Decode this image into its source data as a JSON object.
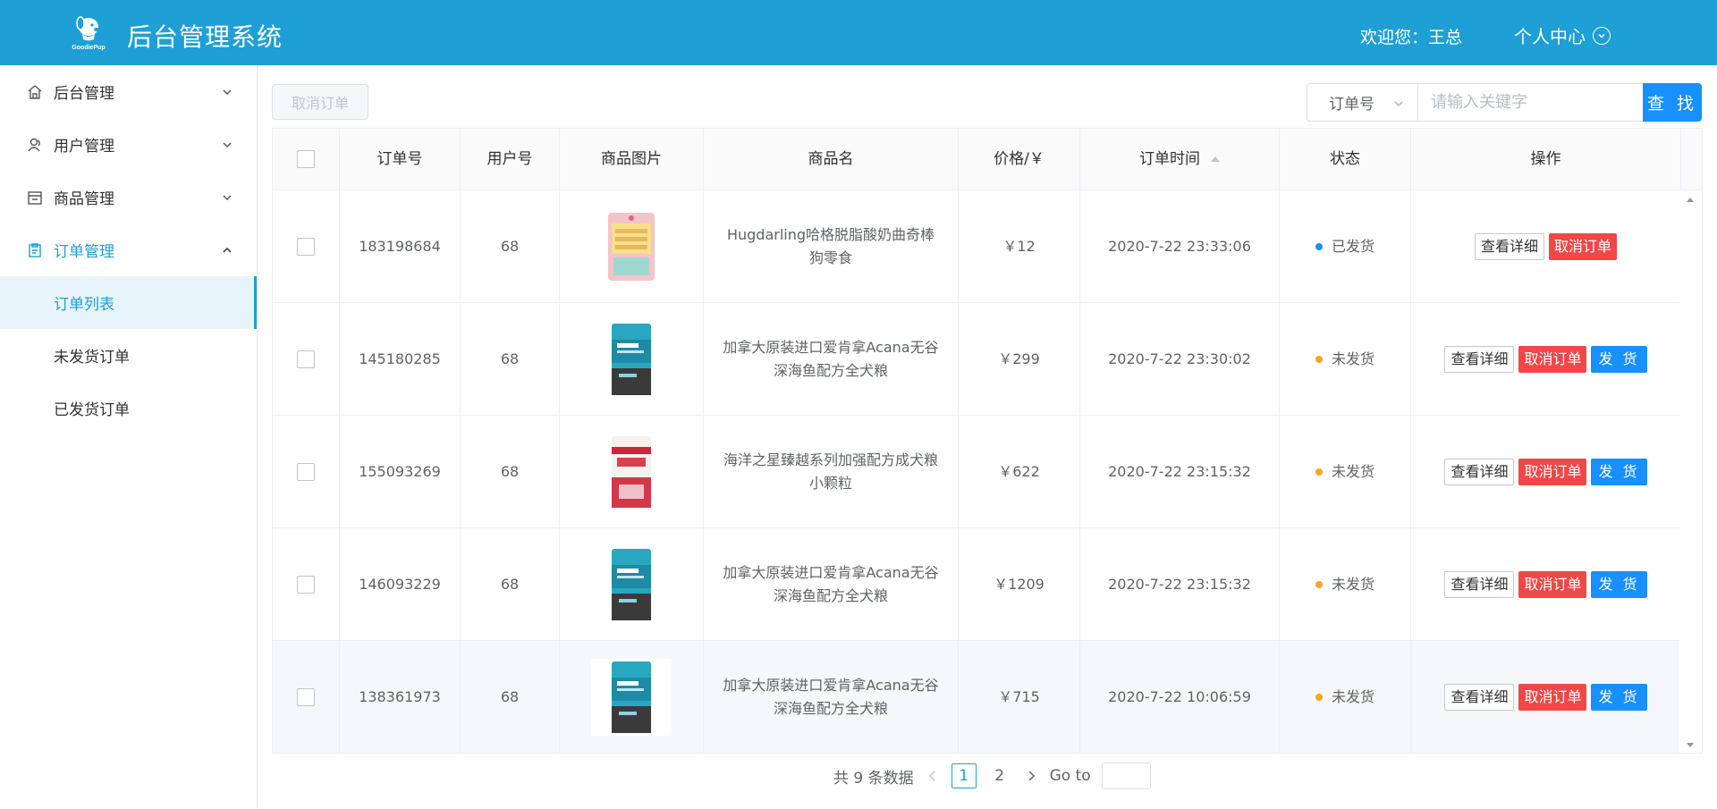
{
  "header": {
    "logo_text": "GoodiePup",
    "title": "后台管理系统",
    "welcome": "欢迎您：王总",
    "profile_label": "个人中心"
  },
  "sidebar": {
    "items": [
      {
        "label": "后台管理",
        "icon": "home-icon"
      },
      {
        "label": "用户管理",
        "icon": "users-icon"
      },
      {
        "label": "商品管理",
        "icon": "store-icon"
      },
      {
        "label": "订单管理",
        "icon": "clipboard-icon"
      }
    ],
    "sub_items": [
      {
        "label": "订单列表"
      },
      {
        "label": "未发货订单"
      },
      {
        "label": "已发货订单"
      }
    ]
  },
  "toolbar": {
    "cancel_batch_label": "取消订单",
    "search_field": "订单号",
    "search_placeholder": "请输入关键字",
    "search_button": "查 找"
  },
  "table": {
    "columns": [
      "订单号",
      "用户号",
      "商品图片",
      "商品名",
      "价格/￥",
      "订单时间",
      "状态",
      "操作"
    ],
    "rows": [
      {
        "order_id": "183198684",
        "user_id": "68",
        "name": "Hugdarling哈格脱脂酸奶曲奇棒狗零食",
        "price": "￥12",
        "time": "2020-7-22 23:33:06",
        "status": "已发货",
        "status_color": "#1890ff",
        "img": "treat"
      },
      {
        "order_id": "145180285",
        "user_id": "68",
        "name": "加拿大原装进口爱肯拿Acana无谷深海鱼配方全犬粮",
        "price": "￥299",
        "time": "2020-7-22 23:30:02",
        "status": "未发货",
        "status_color": "#f5a623",
        "img": "acana"
      },
      {
        "order_id": "155093269",
        "user_id": "68",
        "name": "海洋之星臻越系列加强配方成犬粮小颗粒",
        "price": "￥622",
        "time": "2020-7-22 23:15:32",
        "status": "未发货",
        "status_color": "#f5a623",
        "img": "red"
      },
      {
        "order_id": "146093229",
        "user_id": "68",
        "name": "加拿大原装进口爱肯拿Acana无谷深海鱼配方全犬粮",
        "price": "￥1209",
        "time": "2020-7-22 23:15:32",
        "status": "未发货",
        "status_color": "#f5a623",
        "img": "acana"
      },
      {
        "order_id": "138361973",
        "user_id": "68",
        "name": "加拿大原装进口爱肯拿Acana无谷深海鱼配方全犬粮",
        "price": "￥715",
        "time": "2020-7-22 10:06:59",
        "status": "未发货",
        "status_color": "#f5a623",
        "img": "acana"
      }
    ],
    "btn_detail": "查看详细",
    "btn_cancel": "取消订单",
    "btn_ship": "发 货"
  },
  "pagination": {
    "total_text": "共 9 条数据",
    "pages": [
      "1",
      "2"
    ],
    "current": "1",
    "goto_label": "Go to"
  }
}
